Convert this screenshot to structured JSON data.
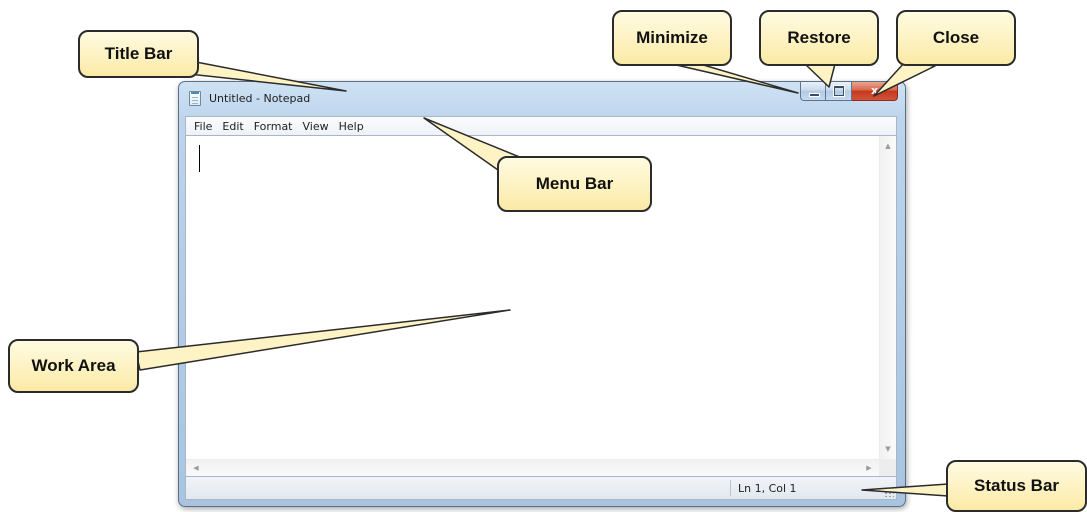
{
  "window": {
    "title": "Untitled - Notepad",
    "app_icon": "notepad-icon",
    "caption_buttons": {
      "minimize": "minimize-icon",
      "maximize": "restore-icon",
      "close_glyph": "x"
    }
  },
  "menu": {
    "items": [
      {
        "label": "File"
      },
      {
        "label": "Edit"
      },
      {
        "label": "Format"
      },
      {
        "label": "View"
      },
      {
        "label": "Help"
      }
    ]
  },
  "status": {
    "position": "Ln 1, Col 1"
  },
  "callouts": {
    "title_bar": "Title Bar",
    "minimize": "Minimize",
    "restore": "Restore",
    "close": "Close",
    "menu_bar": "Menu Bar",
    "work_area": "Work Area",
    "status_bar": "Status Bar"
  },
  "colors": {
    "callout_fill_top": "#fffbe2",
    "callout_fill_bottom": "#fbeaa6",
    "callout_border": "#2b2b2b",
    "close_button": "#c4391c",
    "window_frame": "#a8c4e0"
  }
}
